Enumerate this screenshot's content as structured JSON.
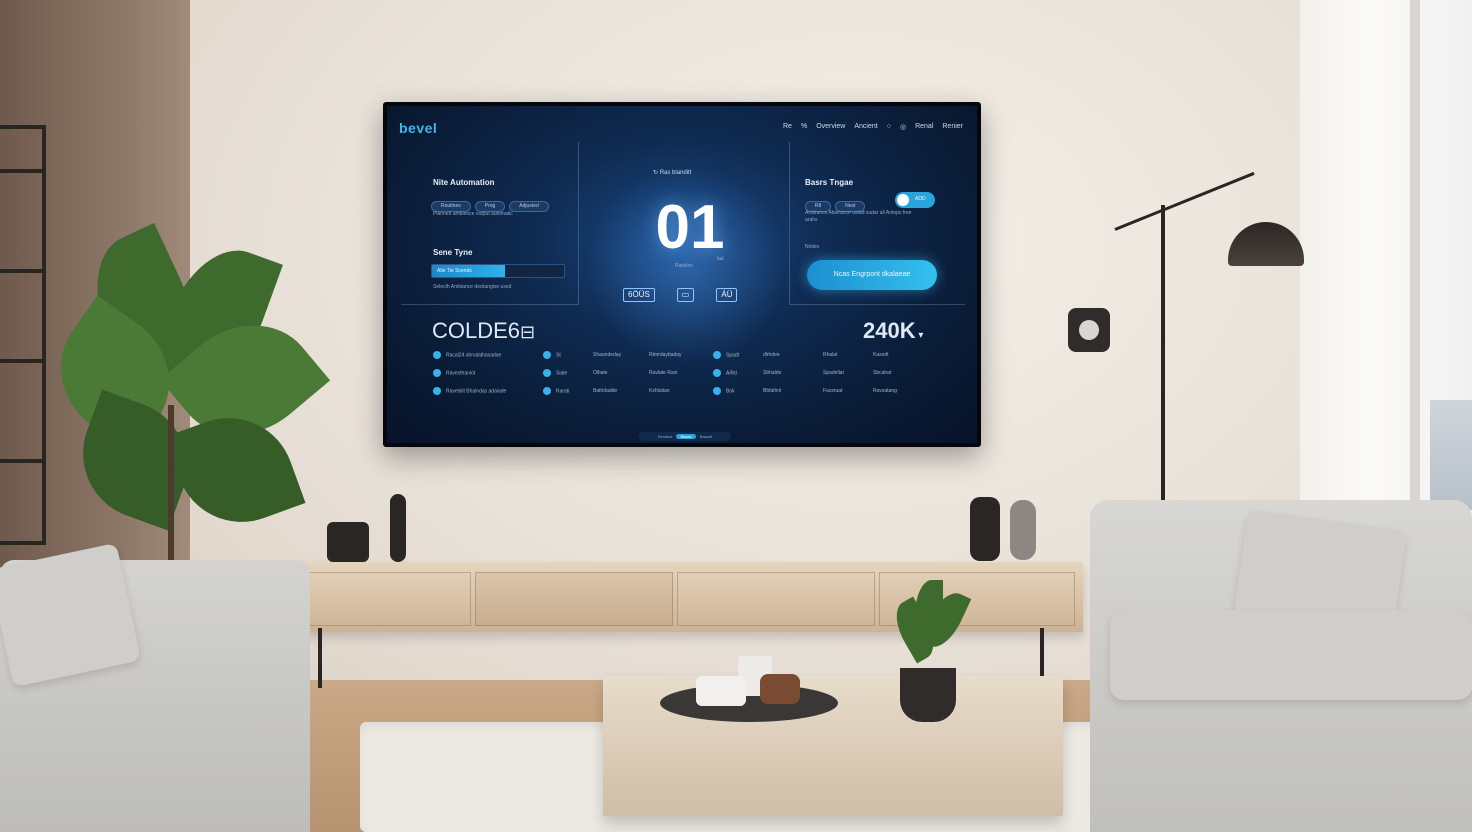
{
  "tv_ui": {
    "brand": "bevel",
    "nav_items": [
      "Re",
      "%",
      "Overview",
      "Ancient",
      "○",
      "◎",
      "Renal",
      "Renier"
    ],
    "automation": {
      "title": "Nite Automation",
      "pills": [
        "Routines",
        "Prog",
        "Adjusted"
      ],
      "note": "Planned ambience output automatic"
    },
    "scene": {
      "title": "Sene Tyne",
      "bar_label": "Alte Tie Scends",
      "bar_fill": 0.55,
      "note": "Selecth Ambiance dedrangise used"
    },
    "center": {
      "caption": "Ras blanditt",
      "value": "01",
      "sub_a": "Rainline",
      "sub_b": "bal",
      "buttons": [
        "6ÖÜS",
        "▭",
        "ÁÜ"
      ]
    },
    "right": {
      "title": "Basrs Tngae",
      "pills": [
        "Rtl",
        "Nest"
      ],
      "toggle_label": "ADD",
      "note": "Ambiance Abierance ustad sudar all Antops free arahs",
      "section": "Noties",
      "cta": "Ncas Engrpont dkalaeae"
    },
    "status_left": "COLDE6",
    "status_icon": "⊟",
    "status_right": "240K",
    "list": [
      [
        "Racal24 ahnalathasadae",
        "St",
        "Shaundeday",
        "Rtmrdaybaday",
        "Spadt",
        "dlrhdee",
        "Rhalat",
        "Kasodt"
      ],
      [
        "Ravesthaniot",
        "Siale",
        "Olbale",
        "Ravlate Ravi",
        "AiRd",
        "Sbhalde",
        "Spadellat",
        "Sbcalrat"
      ],
      [
        "Ravelsilt Bhaindas adaiade",
        "Rarati",
        "Bathdadde",
        "Kshlutian",
        "Bok",
        "Bbfafinit",
        "Fassruat",
        "Ravsatang"
      ]
    ],
    "pager": [
      "Renaise",
      "Basee",
      "Basant"
    ]
  },
  "colors": {
    "accent": "#2aa4dc",
    "screen_bg": "#0f2b52"
  }
}
